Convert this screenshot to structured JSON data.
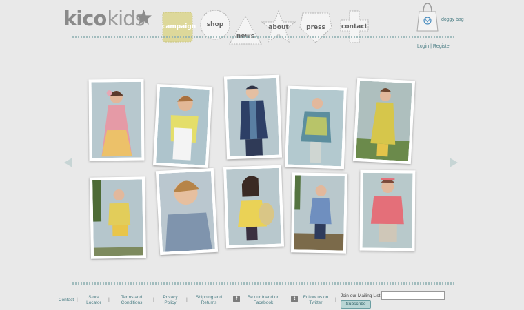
{
  "brand": {
    "word1": "kico",
    "word2": "kids"
  },
  "nav": [
    {
      "id": "campaign",
      "label": "campaign",
      "shape": "square",
      "active": true
    },
    {
      "id": "shop",
      "label": "shop",
      "shape": "circle",
      "active": false
    },
    {
      "id": "news",
      "label": "news",
      "shape": "triangle",
      "active": false
    },
    {
      "id": "about",
      "label": "about",
      "shape": "star",
      "active": false
    },
    {
      "id": "press",
      "label": "press",
      "shape": "pentagon",
      "active": false
    },
    {
      "id": "contact",
      "label": "contact",
      "shape": "cross",
      "active": false
    }
  ],
  "header": {
    "doggy_bag_label": "doggy bag",
    "login_label": "Login",
    "separator": "|",
    "register_label": "Register"
  },
  "gallery": {
    "prev_icon": "arrow-left-icon",
    "next_icon": "arrow-right-icon",
    "photos": [
      {
        "subject": "girl-pink-dress"
      },
      {
        "subject": "boy-yellow-tee"
      },
      {
        "subject": "boy-navy-blazer"
      },
      {
        "subject": "girl-fringe-top"
      },
      {
        "subject": "girl-yellow-outfit"
      },
      {
        "subject": "girl-yellow-shorts"
      },
      {
        "subject": "boy-chambray-shirt"
      },
      {
        "subject": "girl-yellow-dress-basket"
      },
      {
        "subject": "girl-blue-dress"
      },
      {
        "subject": "girl-pink-knit"
      }
    ]
  },
  "footer": {
    "links": [
      {
        "label": "Contact"
      },
      {
        "label": "Store\nLocator"
      },
      {
        "label": "Terms and\nConditions"
      },
      {
        "label": "Privacy\nPolicy"
      },
      {
        "label": "Shipping and\nReturns"
      },
      {
        "label": "Be our friend on\nFacebook"
      },
      {
        "label": "Follow us on\nTwitter"
      }
    ],
    "mailing_label": "Join our Mailing List:",
    "mailing_value": "",
    "subscribe_label": "Subscribe"
  },
  "colors": {
    "background": "#e9e9e9",
    "link": "#4d7f86",
    "campaign_active": "#ddd89a",
    "stitch": "#8fb0b2"
  }
}
